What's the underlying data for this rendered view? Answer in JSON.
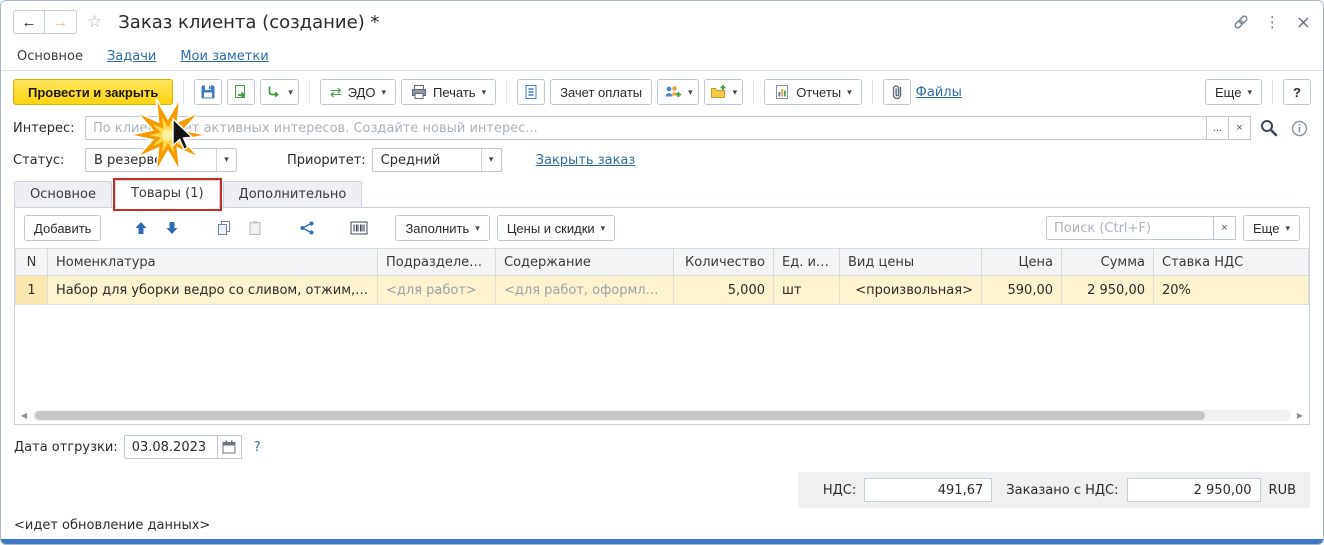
{
  "colors": {
    "accent_yellow": "#FFD513",
    "link_blue": "#2E6DA4",
    "selected_row": "#FDF3D1",
    "annotation_red": "#C92A2A",
    "bottom_strip": "#3F7ABE"
  },
  "icons": {
    "back": "←",
    "forward": "→",
    "star": "☆",
    "kebab": "⋮",
    "close": "×",
    "caret": "▾",
    "ellipsis": "...",
    "clear": "×",
    "question": "?",
    "info": "i",
    "edo_swap": "⇄",
    "scroll_left": "◀",
    "scroll_right": "▶"
  },
  "titlebar": {
    "title": "Заказ клиента (создание) *"
  },
  "nav": {
    "items": [
      {
        "label": "Основное"
      },
      {
        "label": "Задачи"
      },
      {
        "label": "Мои заметки"
      }
    ]
  },
  "toolbar": {
    "post_and_close": "Провести и закрыть",
    "edo": "ЭДО",
    "print": "Печать",
    "payment_offset": "Зачет оплаты",
    "reports": "Отчеты",
    "files": "Файлы",
    "more": "Еще",
    "help": "?"
  },
  "interest": {
    "label": "Интерес:",
    "placeholder": "По клиенту нет активных интересов. Создайте новый интерес..."
  },
  "status_row": {
    "status_label": "Статус:",
    "status_value": "В резерве",
    "priority_label": "Приоритет:",
    "priority_value": "Средний",
    "close_order_link": "Закрыть заказ"
  },
  "tabs": [
    {
      "label": "Основное"
    },
    {
      "label": "Товары (1)"
    },
    {
      "label": "Дополнительно"
    }
  ],
  "table_toolbar": {
    "add": "Добавить",
    "fill": "Заполнить",
    "prices_discounts": "Цены и скидки",
    "search_placeholder": "Поиск (Ctrl+F)",
    "more": "Еще"
  },
  "table": {
    "columns": [
      "N",
      "Номенклатура",
      "Подразделени…",
      "Содержание",
      "Количество",
      "Ед. изм.",
      "Вид цены",
      "Цена",
      "Сумма",
      "Ставка НДС"
    ],
    "rows": [
      {
        "n": "1",
        "nomenclature": "Набор для уборки ведро со сливом, отжим, …",
        "department": "<для работ>",
        "content": "<для работ, оформляем…",
        "quantity": "5,000",
        "unit": "шт",
        "price_type": "<произвольная>",
        "price": "590,00",
        "amount": "2 950,00",
        "vat_rate": "20%"
      }
    ]
  },
  "shipment": {
    "label": "Дата отгрузки:",
    "date": "03.08.2023",
    "help": "?"
  },
  "totals": {
    "vat_label": "НДС:",
    "vat_value": "491,67",
    "total_label": "Заказано с НДС:",
    "total_value": "2 950,00",
    "currency": "RUB"
  },
  "statusbar": {
    "message": "<идет обновление данных>"
  }
}
